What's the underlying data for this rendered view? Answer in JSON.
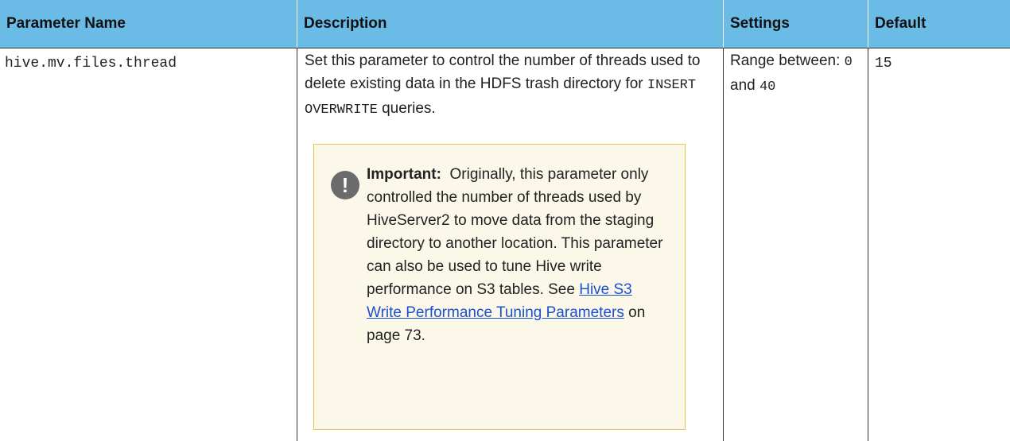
{
  "table": {
    "headers": {
      "parameter_name": "Parameter Name",
      "description": "Description",
      "settings": "Settings",
      "default": "Default"
    },
    "row": {
      "parameter": "hive.mv.files.thread",
      "description_part1": "Set this parameter to control the number of threads used to delete existing data in the HDFS trash directory for ",
      "description_code": "INSERT OVERWRITE",
      "description_part2": " queries.",
      "settings_prefix": "Range between: ",
      "settings_min": "0",
      "settings_and": " and ",
      "settings_max": "40",
      "default": "15"
    }
  },
  "note": {
    "label": "Important:",
    "text_before_link": "Originally, this parameter only controlled the number of threads used by HiveServer2 to move data from the staging directory to another location. This parameter can also be used to tune Hive write performance on S3 tables. See ",
    "link_text": "Hive S3 Write Performance Tuning Parameters",
    "text_after_link": " on page 73.",
    "icon": "exclamation-icon"
  },
  "colors": {
    "header_bg": "#6bbbe7",
    "note_bg": "#fbf8ea",
    "note_border": "#f0c24a",
    "link": "#1a4fd0"
  }
}
